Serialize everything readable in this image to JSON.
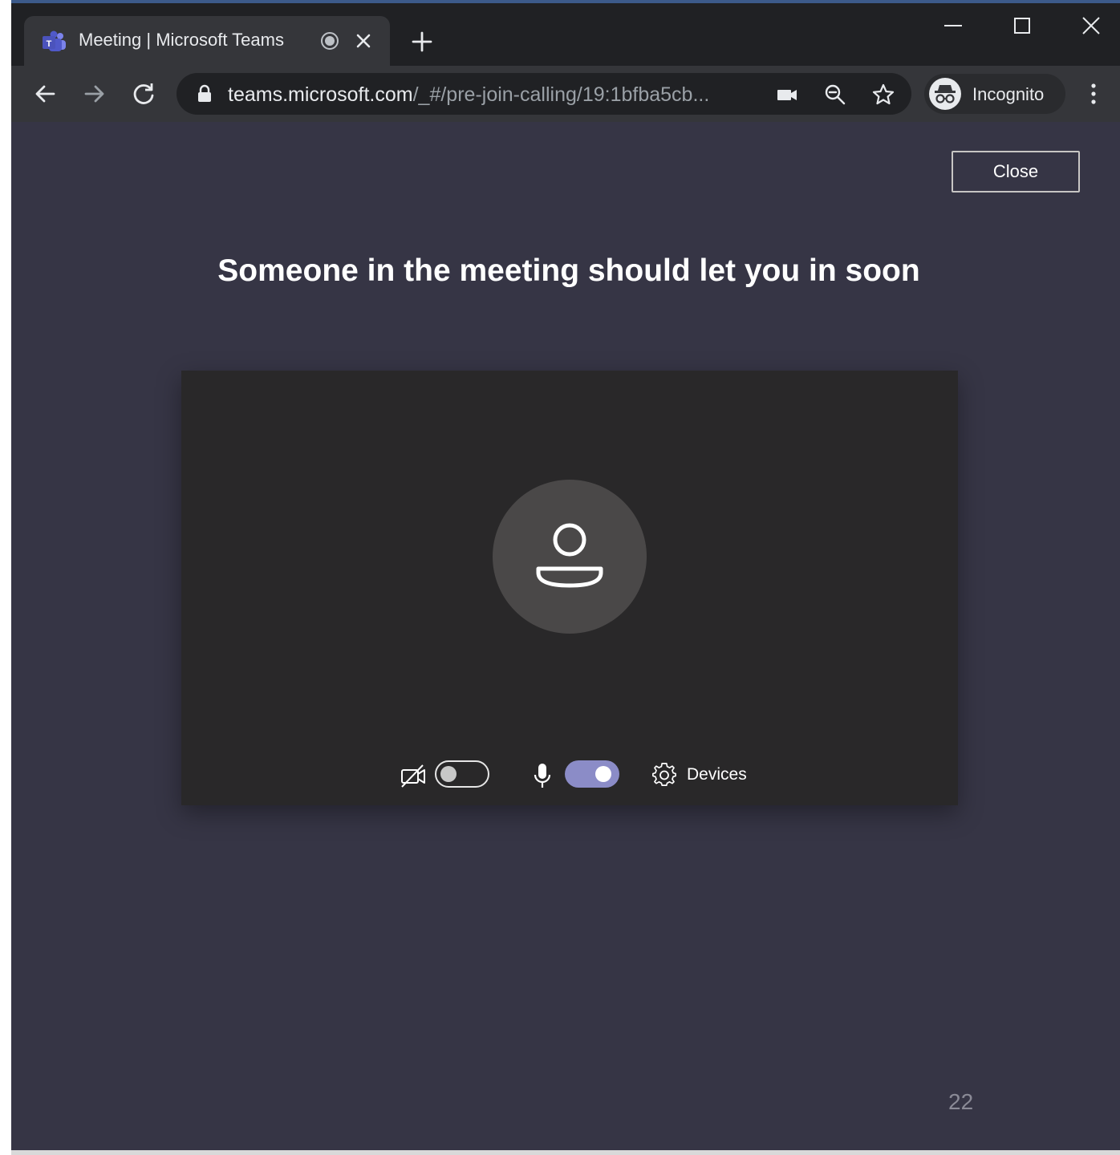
{
  "browser": {
    "tab_title": "Meeting | Microsoft Teams",
    "url_host": "teams.microsoft.com",
    "url_rest": "/_#/pre-join-calling/19:1bfba5cb...",
    "profile_label": "Incognito"
  },
  "meeting": {
    "close_label": "Close",
    "headline": "Someone in the meeting should let you in soon",
    "camera_on": false,
    "mic_on": true,
    "devices_label": "Devices"
  },
  "slide": {
    "number": "22"
  },
  "colors": {
    "stage_bg": "#363545",
    "preview_bg": "#292829",
    "toggle_on": "#8b8cc7",
    "chrome_dark": "#202124"
  },
  "icons": [
    "teams-logo-icon",
    "recording-icon",
    "tab-close-icon",
    "plus-icon",
    "minimize-icon",
    "maximize-icon",
    "window-close-icon",
    "back-arrow-icon",
    "forward-arrow-icon",
    "reload-icon",
    "lock-icon",
    "camera-icon",
    "zoom-icon",
    "star-icon",
    "incognito-icon",
    "more-vert-icon",
    "avatar-person-icon",
    "camera-off-icon",
    "microphone-icon",
    "gear-icon"
  ]
}
